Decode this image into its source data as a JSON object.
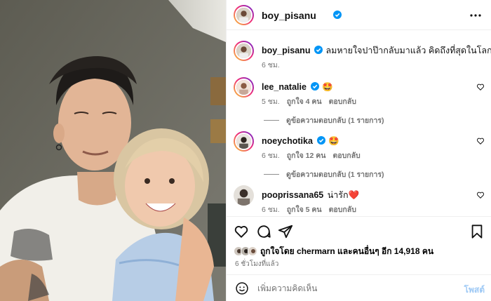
{
  "post": {
    "username": "boy_pisanu",
    "more_icon": "more-horizontal-icon"
  },
  "caption": {
    "username": "boy_pisanu",
    "text": "ลมหายใจปาป๊ากลับมาแล้ว คิดถึงที่สุดในโลกเลยลูก",
    "emoji": "❤️",
    "time": "6 ชม."
  },
  "comments": [
    {
      "username": "lee_natalie",
      "verified": true,
      "text": "🤩",
      "time": "5 ชม.",
      "likes": "ถูกใจ 4 คน",
      "reply": "ตอบกลับ",
      "view_replies": "ดูข้อความตอบกลับ (1 รายการ)"
    },
    {
      "username": "noeychotika",
      "verified": true,
      "text": "🤩",
      "time": "6 ชม.",
      "likes": "ถูกใจ 12 คน",
      "reply": "ตอบกลับ",
      "view_replies": "ดูข้อความตอบกลับ (1 รายการ)"
    },
    {
      "username": "pooprissana65",
      "verified": false,
      "text": "น่ารัก",
      "emoji": "❤️",
      "time": "6 ชม.",
      "likes": "ถูกใจ 5 คน",
      "reply": "ตอบกลับ"
    }
  ],
  "likes_summary": "ถูกใจโดย chermarn และคนอื่นๆ อีก 14,918 คน",
  "timestamp": "6 ชั่วโมงที่แล้ว",
  "add_comment": {
    "placeholder": "เพิ่มความคิดเห็น",
    "post_label": "โพสต์"
  },
  "colors": {
    "verified": "#0095f6",
    "heart_red": "#ed1c2e",
    "post_disabled": "#9ec9f5",
    "secondary_text": "#737373"
  }
}
